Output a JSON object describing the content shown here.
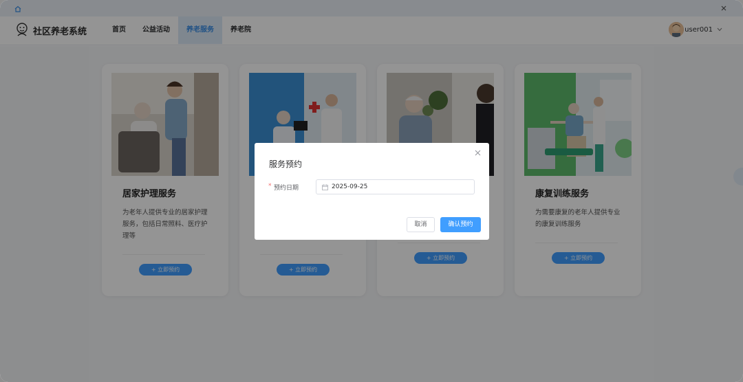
{
  "app": {
    "title": "社区养老系统"
  },
  "nav": {
    "items": [
      {
        "label": "首页",
        "active": false
      },
      {
        "label": "公益活动",
        "active": false
      },
      {
        "label": "养老服务",
        "active": true
      },
      {
        "label": "养老院",
        "active": false
      }
    ]
  },
  "user": {
    "name": "user001"
  },
  "cards": [
    {
      "title": "居家护理服务",
      "desc": "为老年人提供专业的居家护理服务，包括日常照料、医疗护理等",
      "button": "+ 立即预约",
      "image": "caregiver-with-elderly-man-photo"
    },
    {
      "title": "",
      "desc": "",
      "button": "+ 立即预约",
      "image": "doctor-consulting-elderly-patient-photo"
    },
    {
      "title": "",
      "desc": "",
      "button": "+ 立即预约",
      "image": "elderly-man-talking-with-woman-photo"
    },
    {
      "title": "康复训练服务",
      "desc": "为需要康复的老年人提供专业的康复训练服务",
      "button": "+ 立即预约",
      "image": "rehabilitation-exercise-photo"
    }
  ],
  "dialog": {
    "title": "服务预约",
    "required_mark": "*",
    "field_label": "预约日期",
    "date_value": "2025-09-25",
    "cancel_label": "取消",
    "confirm_label": "确认预约"
  },
  "colors": {
    "primary": "#409eff",
    "active_nav_bg": "#dbe8f6",
    "required": "#f56c6c"
  }
}
